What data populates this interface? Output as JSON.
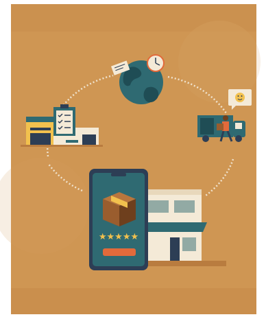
{
  "illustration": {
    "stars_rating": "★★★★★",
    "colors": {
      "background": "#ffffff",
      "parchment": "#cf9653",
      "parchment_dark": "#b97c3f",
      "teal": "#2f6a72",
      "teal_dark": "#1f4d55",
      "navy": "#2d3e55",
      "orange": "#e26a3b",
      "yellow": "#f2c14e",
      "cream": "#f4ead7",
      "box": "#9a5d2e",
      "box_dark": "#6e3f1d",
      "white_stroke": "#f3ead9"
    },
    "icons": [
      "globe-icon",
      "clock-icon",
      "ticket-icon",
      "warehouse-icon",
      "clipboard-checklist-icon",
      "delivery-van-icon",
      "courier-icon",
      "smiley-speech-bubble-icon",
      "smartphone-icon",
      "package-box-icon",
      "storefront-icon"
    ]
  }
}
